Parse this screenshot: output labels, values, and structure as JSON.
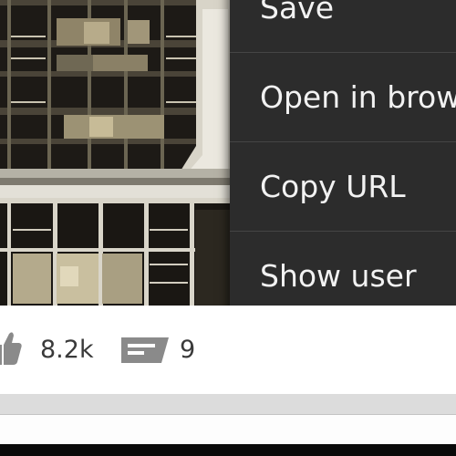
{
  "menu": {
    "items": [
      {
        "label": "Save"
      },
      {
        "label": "Open in browser"
      },
      {
        "label": "Copy URL"
      },
      {
        "label": "Show user"
      }
    ]
  },
  "stats": {
    "likes": "8.2k",
    "comments": "9",
    "like_icon": "thumbs-up-icon",
    "comment_icon": "comment-icon"
  },
  "colors": {
    "menu_bg": "#2c2c2c",
    "menu_text": "#f2f2f2",
    "icon_gray": "#8a8a8a",
    "count_text": "#3a3a3a"
  }
}
